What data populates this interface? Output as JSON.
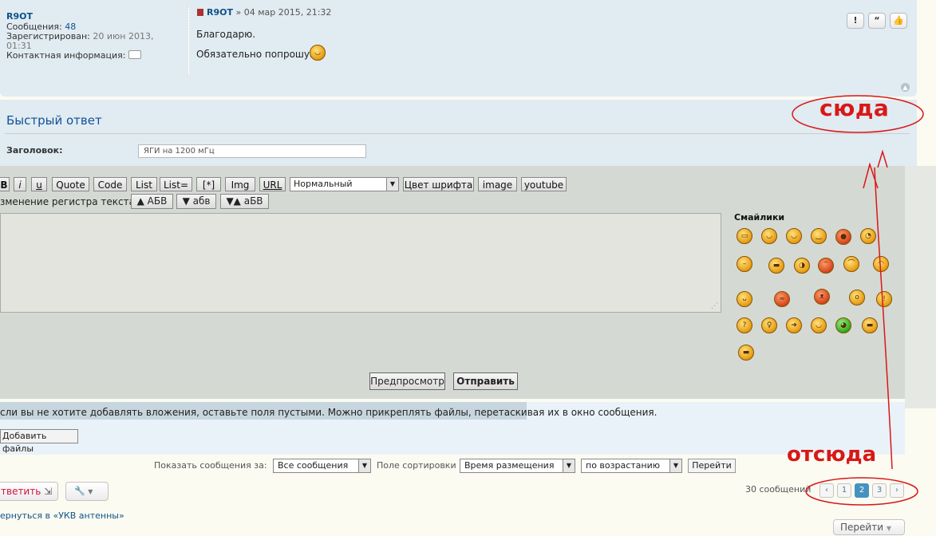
{
  "post": {
    "author": "R9OT",
    "info": [
      {
        "label": "Сообщения:",
        "value": "48"
      },
      {
        "label": "Зарегистрирован:",
        "value": "20 июн 2013,"
      },
      {
        "label": "",
        "value": "01:31"
      },
      {
        "label": "Контактная информация:",
        "value": ""
      }
    ],
    "head_author": "R9OT",
    "head_date": "» 04 мар 2015, 21:32",
    "lines": [
      "Благодарю.",
      "Обязательно попрошу."
    ],
    "buttons": [
      "!",
      "“",
      "👍"
    ]
  },
  "quick_reply": {
    "title": "Быстрый ответ",
    "subject_label": "Заголовок:",
    "subject_value": "ЯГИ на 1200 мГц",
    "toolbar": [
      "B",
      "i",
      "u",
      "Quote",
      "Code",
      "List",
      "List=",
      "[*]",
      "Img",
      "URL"
    ],
    "font_size": "Нормальный",
    "toolbar2": [
      "Цвет шрифта",
      "image",
      "youtube"
    ],
    "case_label": "зменение регистра текста:",
    "case_buttons": [
      "▲ АБВ",
      "▼ абв",
      "▼▲ аБВ"
    ],
    "smilies_title": "Смайлики",
    "preview": "Предпросмотр",
    "submit": "Отправить"
  },
  "attach": {
    "text": "сли вы не хотите добавлять вложения, оставьте поля пустыми. Можно прикреплять файлы, перетаскивая их в окно сообщения.",
    "button": "Добавить файлы"
  },
  "sort": {
    "show_label": "Показать сообщения за:",
    "show_value": "Все сообщения",
    "sort_label": "Поле сортировки",
    "sort_value": "Время размещения",
    "order_value": "по возрастанию",
    "go": "Перейти"
  },
  "bottom": {
    "reply": "тветить",
    "count": "30 сообщений",
    "pages": [
      "1",
      "2",
      "3"
    ],
    "back": "ернуться в «УКВ антенны»",
    "jump": "Перейти"
  },
  "annotations": {
    "here": "сюда",
    "from": "отсюда",
    "color": "#d81818"
  }
}
